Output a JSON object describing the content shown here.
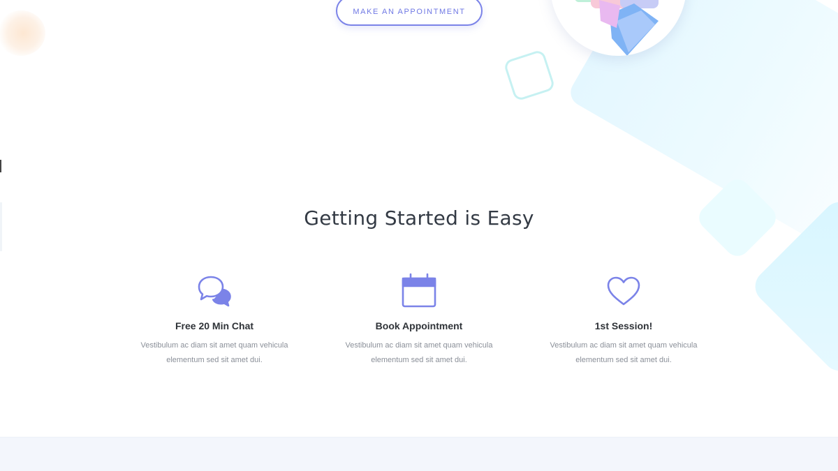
{
  "hero": {
    "cta_label": "MAKE AN APPOINTMENT"
  },
  "getting_started": {
    "title": "Getting Started is Easy",
    "features": [
      {
        "icon": "chat-bubbles-icon",
        "title": "Free 20 Min Chat",
        "description": "Vestibulum ac diam sit amet quam vehicula elementum sed sit amet dui."
      },
      {
        "icon": "calendar-icon",
        "title": "Book Appointment",
        "description": "Vestibulum ac diam sit amet quam vehicula elementum sed sit amet dui."
      },
      {
        "icon": "heart-icon",
        "title": "1st Session!",
        "description": "Vestibulum ac diam sit amet quam vehicula elementum sed sit amet dui."
      }
    ]
  },
  "colors": {
    "accent": "#7b83e8",
    "heading": "#333a44",
    "body_text": "#8a8f98",
    "bottom_band": "#f3f6fc"
  }
}
